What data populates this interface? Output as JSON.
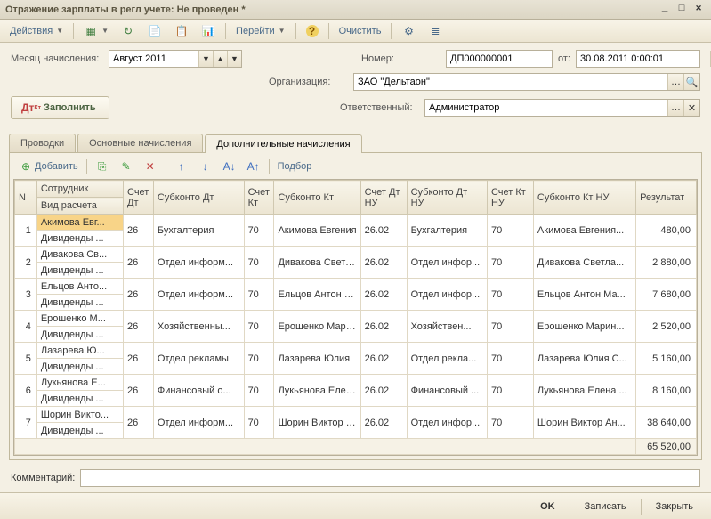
{
  "window_title": "Отражение зарплаты в регл учете: Не проведен *",
  "toolbar": {
    "actions": "Действия",
    "goto": "Перейти",
    "clear": "Очистить"
  },
  "header": {
    "period_label": "Месяц начисления:",
    "period_value": "Август 2011",
    "number_label": "Номер:",
    "number_value": "ДП000000001",
    "from_label": "от:",
    "from_value": "30.08.2011 0:00:01",
    "org_label": "Организация:",
    "org_value": "ЗАО \"Дельтаон\"",
    "resp_label": "Ответственный:",
    "resp_value": "Администратор",
    "fill": "Заполнить"
  },
  "tabs": {
    "t1": "Проводки",
    "t2": "Основные начисления",
    "t3": "Дополнительные начисления"
  },
  "grid_toolbar": {
    "add": "Добавить",
    "select": "Подбор"
  },
  "columns": {
    "n": "N",
    "emp": "Сотрудник",
    "calc": "Вид расчета",
    "acc_dt": "Счет Дт",
    "sub_dt": "Субконто Дт",
    "acc_kt": "Счет Кт",
    "sub_kt": "Субконто Кт",
    "acc_dt_nu": "Счет Дт НУ",
    "sub_dt_nu": "Субконто Дт НУ",
    "acc_kt_nu": "Счет Кт НУ",
    "sub_kt_nu": "Субконто Кт НУ",
    "result": "Результат"
  },
  "rows": [
    {
      "n": "1",
      "emp": "Акимова Евг...",
      "calc": "Дивиденды ...",
      "acc_dt": "26",
      "sub_dt": "Бухгалтерия",
      "acc_kt": "70",
      "sub_kt": "Акимова Евгения",
      "acc_dt_nu": "26.02",
      "sub_dt_nu": "Бухгалтерия",
      "acc_kt_nu": "70",
      "sub_kt_nu": "Акимова Евгения...",
      "result": "480,00",
      "sel": true
    },
    {
      "n": "2",
      "emp": "Дивакова Св...",
      "calc": "Дивиденды ...",
      "acc_dt": "26",
      "sub_dt": "Отдел информ...",
      "acc_kt": "70",
      "sub_kt": "Дивакова Светлана",
      "acc_dt_nu": "26.02",
      "sub_dt_nu": "Отдел инфор...",
      "acc_kt_nu": "70",
      "sub_kt_nu": "Дивакова Светла...",
      "result": "2 880,00"
    },
    {
      "n": "3",
      "emp": "Ельцов Анто...",
      "calc": "Дивиденды ...",
      "acc_dt": "26",
      "sub_dt": "Отдел информ...",
      "acc_kt": "70",
      "sub_kt": "Ельцов Антон Максимович",
      "acc_dt_nu": "26.02",
      "sub_dt_nu": "Отдел инфор...",
      "acc_kt_nu": "70",
      "sub_kt_nu": "Ельцов Антон Ма...",
      "result": "7 680,00"
    },
    {
      "n": "4",
      "emp": "Ерошенко М...",
      "calc": "Дивиденды ...",
      "acc_dt": "26",
      "sub_dt": "Хозяйственны...",
      "acc_kt": "70",
      "sub_kt": "Ерошенко Марина",
      "acc_dt_nu": "26.02",
      "sub_dt_nu": "Хозяйствен...",
      "acc_kt_nu": "70",
      "sub_kt_nu": "Ерошенко Марин...",
      "result": "2 520,00"
    },
    {
      "n": "5",
      "emp": "Лазарева Ю...",
      "calc": "Дивиденды ...",
      "acc_dt": "26",
      "sub_dt": "Отдел рекламы",
      "acc_kt": "70",
      "sub_kt": "Лазарева Юлия",
      "acc_dt_nu": "26.02",
      "sub_dt_nu": "Отдел рекла...",
      "acc_kt_nu": "70",
      "sub_kt_nu": "Лазарева Юлия С...",
      "result": "5 160,00"
    },
    {
      "n": "6",
      "emp": "Лукьянова Е...",
      "calc": "Дивиденды ...",
      "acc_dt": "26",
      "sub_dt": "Финансовый о...",
      "acc_kt": "70",
      "sub_kt": "Лукьянова Елена",
      "acc_dt_nu": "26.02",
      "sub_dt_nu": "Финансовый ...",
      "acc_kt_nu": "70",
      "sub_kt_nu": "Лукьянова Елена ...",
      "result": "8 160,00"
    },
    {
      "n": "7",
      "emp": "Шорин Викто...",
      "calc": "Дивиденды ...",
      "acc_dt": "26",
      "sub_dt": "Отдел информ...",
      "acc_kt": "70",
      "sub_kt": "Шорин Виктор Андреевич",
      "acc_dt_nu": "26.02",
      "sub_dt_nu": "Отдел инфор...",
      "acc_kt_nu": "70",
      "sub_kt_nu": "Шорин Виктор Ан...",
      "result": "38 640,00"
    }
  ],
  "sum": "65 520,00",
  "comment_label": "Комментарий:",
  "footer": {
    "ok": "OK",
    "write": "Записать",
    "close": "Закрыть"
  }
}
